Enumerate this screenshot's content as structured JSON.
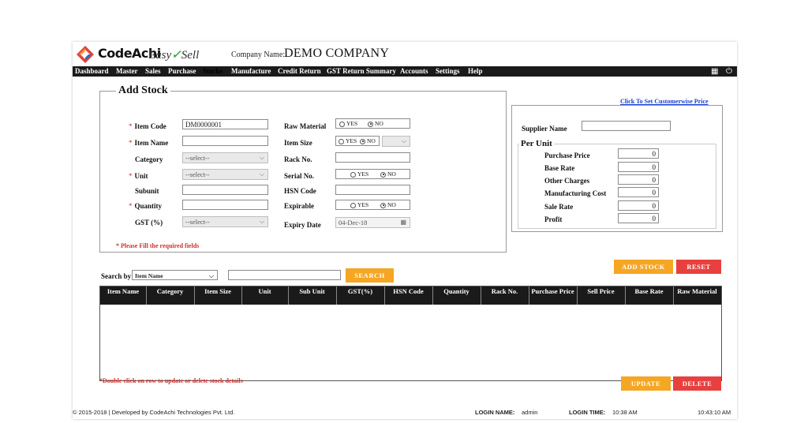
{
  "header": {
    "brand": "CodeAchi",
    "product_part1": "Easy",
    "product_part2": "Sell",
    "company_label": "Company Name:",
    "company_name": "DEMO COMPANY"
  },
  "menu": [
    {
      "label": "Dashboard"
    },
    {
      "label": "Master"
    },
    {
      "label": "Sales"
    },
    {
      "label": "Purchase"
    },
    {
      "label": "Stocks",
      "active": true
    },
    {
      "label": "Manufacture"
    },
    {
      "label": "Credit Return"
    },
    {
      "label": "GST Return Summary"
    },
    {
      "label": "Accounts"
    },
    {
      "label": "Settings"
    },
    {
      "label": "Help"
    }
  ],
  "menu_icons": [
    "calculator-icon",
    "power-icon"
  ],
  "form": {
    "title": "Add Stock",
    "customerwise_link": "Click To Set Customerwise Price",
    "item_code_label": "Item Code",
    "item_code_value": "DM0000001",
    "item_name_label": "Item Name",
    "category_label": "Category",
    "category_value": "--select--",
    "unit_label": "Unit",
    "unit_value": "--select--",
    "subunit_label": "Subunit",
    "quantity_label": "Quantity",
    "gst_label": "GST (%)",
    "gst_value": "--select--",
    "raw_material_label": "Raw Material",
    "item_size_label": "Item Size",
    "rack_label": "Rack No.",
    "serial_label": "Serial No.",
    "hsn_label": "HSN Code",
    "expirable_label": "Expirable",
    "expiry_label": "Expiry Date",
    "expiry_value": "04-Dec-18",
    "yes": "YES",
    "no": "NO",
    "required_note": "* Please Fill the required fields",
    "required_mark": "*"
  },
  "pricing": {
    "supplier_label": "Supplier Name",
    "per_unit_title": "Per Unit",
    "rows": [
      {
        "label": "Purchase Price",
        "value": "0"
      },
      {
        "label": "Base Rate",
        "value": "0"
      },
      {
        "label": "Other Charges",
        "value": "0"
      },
      {
        "label": "Manufacturing Cost",
        "value": "0"
      },
      {
        "label": "Sale Rate",
        "value": "0"
      },
      {
        "label": "Profit",
        "value": "0"
      }
    ]
  },
  "actions": {
    "add_stock": "ADD STOCK",
    "reset": "RESET",
    "update": "UPDATE",
    "delete": "DELETE"
  },
  "search": {
    "label": "Search by",
    "field_value": "Item Name",
    "button": "SEARCH"
  },
  "table": {
    "columns": [
      "Item Name",
      "Category",
      "Item Size",
      "Unit",
      "Sub Unit",
      "GST(%)",
      "HSN Code",
      "Quantity",
      "Rack No.",
      "Purchase Price",
      "Sell Price",
      "Base Rate",
      "Raw Material"
    ]
  },
  "hint": "*Double click on row to update or delete stock details",
  "footer": {
    "copyright": "© 2015-2018 | Developed by CodeAchi Technologies Pvt. Ltd.",
    "login_name_label": "LOGIN NAME:",
    "login_name": "admin",
    "login_time_label": "LOGIN TIME:",
    "login_time": "10:38 AM",
    "clock": "10:43:10 AM"
  },
  "colors": {
    "accent_orange": "#f5a623",
    "accent_red": "#e8403f",
    "menubar": "#1a1a1a",
    "link": "#1a3fd1"
  }
}
